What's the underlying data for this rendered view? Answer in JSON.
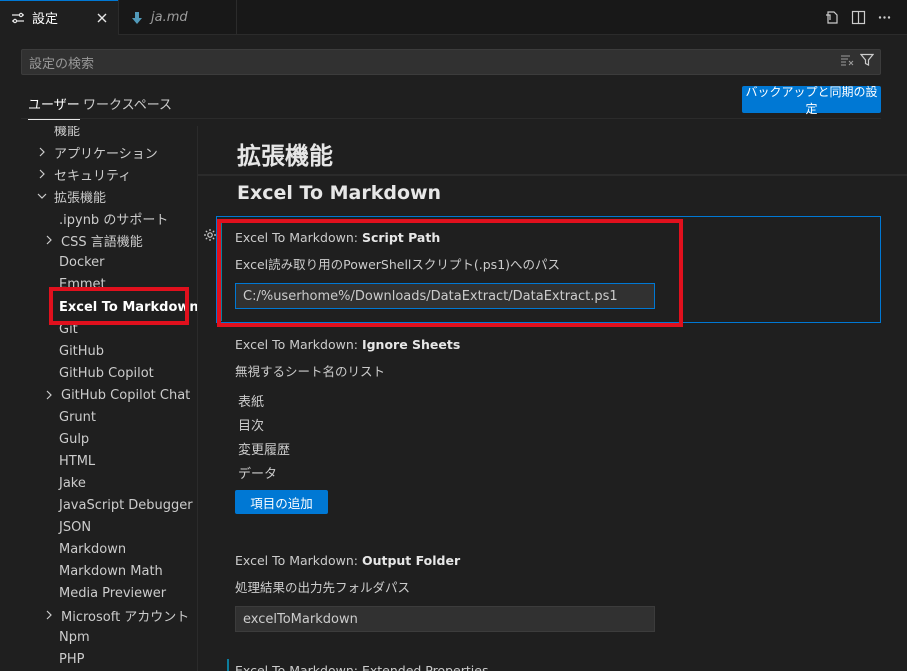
{
  "tabs": [
    {
      "label": "設定",
      "icon": "settings-icon",
      "close": "×"
    },
    {
      "label": "ja.md",
      "icon": "markdown-arrow-icon"
    }
  ],
  "editor_actions": [
    "open-settings-json-icon",
    "split-editor-icon",
    "more-actions-icon"
  ],
  "search": {
    "placeholder": "設定の検索",
    "icons": [
      "filter-clear-icon",
      "filter-icon"
    ]
  },
  "scope": {
    "user": "ユーザー",
    "workspace": "ワークスペース",
    "sync_button": "バックアップと同期の設定"
  },
  "toc": {
    "partial_top": "機能",
    "items": [
      {
        "label": "アプリケーション",
        "expanded": false
      },
      {
        "label": "セキュリティ",
        "expanded": false
      },
      {
        "label": "拡張機能",
        "expanded": true
      },
      {
        "label": ".ipynb のサポート"
      },
      {
        "label": "CSS 言語機能",
        "expandable": true
      },
      {
        "label": "Docker"
      },
      {
        "label": "Emmet"
      },
      {
        "label": "Excel To Markdown",
        "selected": true
      },
      {
        "label": "Git"
      },
      {
        "label": "GitHub"
      },
      {
        "label": "GitHub Copilot"
      },
      {
        "label": "GitHub Copilot Chat",
        "expandable": true
      },
      {
        "label": "Grunt"
      },
      {
        "label": "Gulp"
      },
      {
        "label": "HTML"
      },
      {
        "label": "Jake"
      },
      {
        "label": "JavaScript Debugger"
      },
      {
        "label": "JSON"
      },
      {
        "label": "Markdown"
      },
      {
        "label": "Markdown Math"
      },
      {
        "label": "Media Previewer"
      },
      {
        "label": "Microsoft アカウント",
        "expandable": true
      },
      {
        "label": "Npm"
      },
      {
        "label": "PHP"
      }
    ]
  },
  "main": {
    "heading": "拡張機能",
    "subheading": "Excel To Markdown",
    "settings": [
      {
        "prefix": "Excel To Markdown: ",
        "name": "Script Path",
        "description": "Excel読み取り用のPowerShellスクリプト(.ps1)へのパス",
        "value": "C:/%userhome%/Downloads/DataExtract/DataExtract.ps1"
      },
      {
        "prefix": "Excel To Markdown: ",
        "name": "Ignore Sheets",
        "description": "無視するシート名のリスト",
        "items": [
          "表紙",
          "目次",
          "変更履歴",
          "データ"
        ],
        "add_button": "項目の追加"
      },
      {
        "prefix": "Excel To Markdown: ",
        "name": "Output Folder",
        "description": "処理結果の出力先フォルダパス",
        "value": "excelToMarkdown"
      }
    ],
    "next_partial": "Excel To Markdown: Extended Properties"
  },
  "colors": {
    "accent": "#0078d4",
    "highlight_box": "#e0101d",
    "background": "#1f1f1f"
  }
}
